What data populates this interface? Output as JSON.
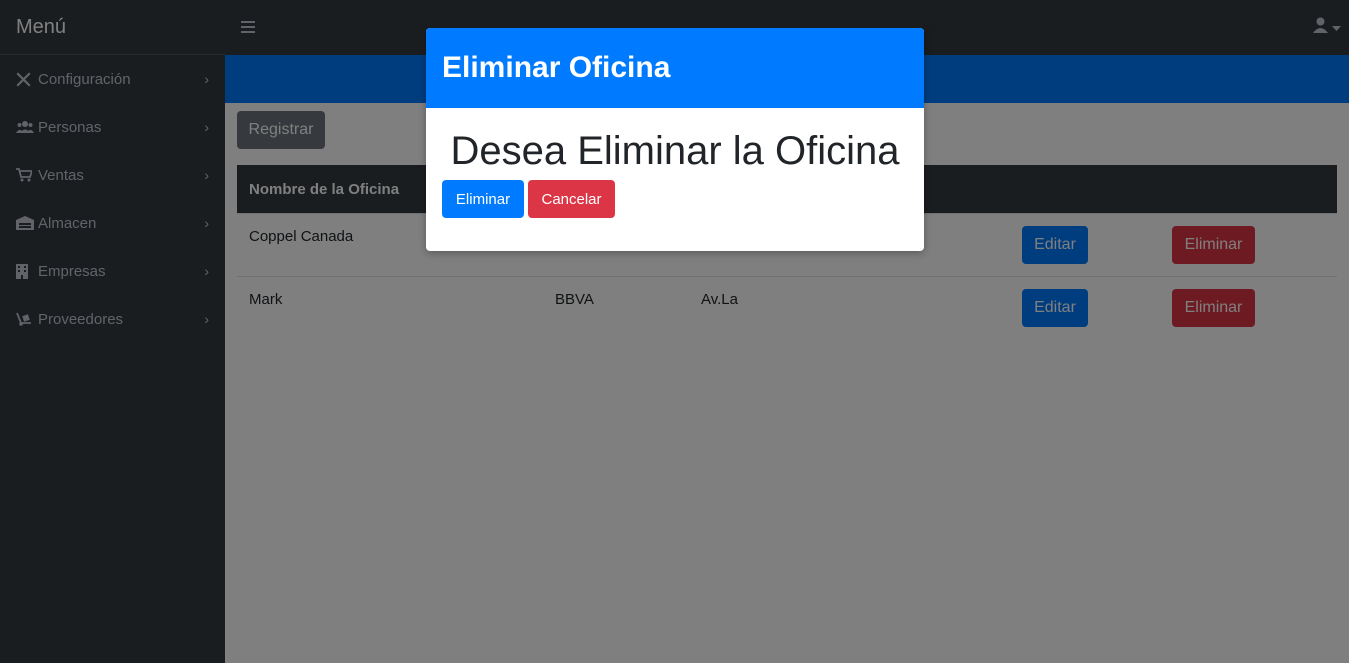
{
  "sidebar": {
    "brand": "Menú",
    "items": [
      {
        "label": "Configuración",
        "icon": "tools-icon"
      },
      {
        "label": "Personas",
        "icon": "users-icon"
      },
      {
        "label": "Ventas",
        "icon": "cart-icon"
      },
      {
        "label": "Almacen",
        "icon": "warehouse-icon"
      },
      {
        "label": "Empresas",
        "icon": "building-icon"
      },
      {
        "label": "Proveedores",
        "icon": "dolly-icon"
      }
    ]
  },
  "topbar": {
    "menu_icon": "hamburger-icon",
    "user_icon": "user-icon"
  },
  "content": {
    "register_label": "Registrar",
    "table": {
      "columns": [
        "Nombre de la Oficina"
      ],
      "rows": [
        {
          "name": "Coppel Canada",
          "bank": "",
          "address": "",
          "edit_label": "Editar",
          "delete_label": "Eliminar"
        },
        {
          "name": "Mark",
          "bank": "BBVA",
          "address": "Av.La",
          "edit_label": "Editar",
          "delete_label": "Eliminar"
        }
      ]
    }
  },
  "modal": {
    "title": "Eliminar Oficina",
    "question": "Desea Eliminar la Oficina",
    "confirm_label": "Eliminar",
    "cancel_label": "Cancelar"
  },
  "colors": {
    "primary": "#007bff",
    "danger": "#dc3545",
    "secondary": "#6c757d",
    "dark": "#343a40"
  }
}
